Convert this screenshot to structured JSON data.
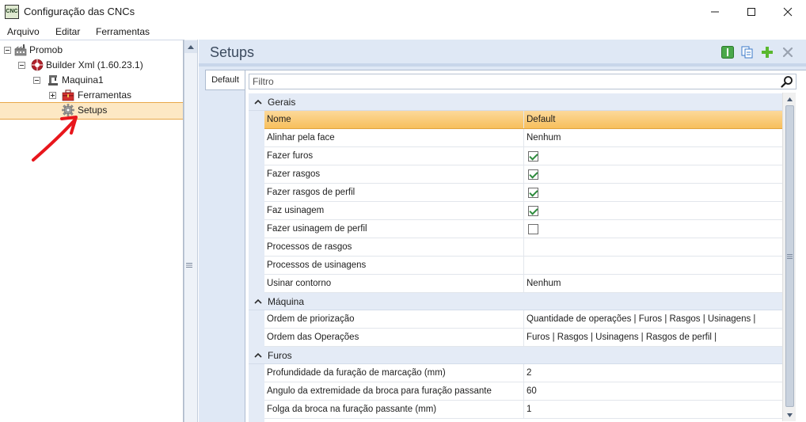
{
  "window": {
    "icon_text": "CNC",
    "title": "Configuração das CNCs"
  },
  "menu": {
    "items": [
      "Arquivo",
      "Editar",
      "Ferramentas"
    ]
  },
  "tree": {
    "nodes": [
      {
        "label": "Promob",
        "icon": "factory-icon",
        "expander": "minus"
      },
      {
        "label": "Builder Xml (1.60.23.1)",
        "icon": "builder-icon",
        "expander": "minus"
      },
      {
        "label": "Maquina1",
        "icon": "machine-icon",
        "expander": "minus"
      },
      {
        "label": "Ferramentas",
        "icon": "toolbox-icon",
        "expander": "plus"
      },
      {
        "label": "Setups",
        "icon": "gear-icon",
        "expander": "none",
        "selected": true
      }
    ]
  },
  "panel": {
    "title": "Setups",
    "toolbar": [
      {
        "icon": "info-icon",
        "color": "#4aa84a"
      },
      {
        "icon": "copy-icon",
        "color": "#3a78c8"
      },
      {
        "icon": "add-icon",
        "color": "#5ab82e"
      },
      {
        "icon": "close-icon",
        "color": "#9aa3b0"
      }
    ]
  },
  "tab": {
    "label": "Default"
  },
  "filter": {
    "placeholder": "Filtro",
    "value": ""
  },
  "grid": {
    "header": {
      "name": "Nome",
      "value": "Default"
    },
    "categories": [
      {
        "label": "Gerais",
        "rows": [
          {
            "name": "Alinhar pela face",
            "value": "Nenhum",
            "type": "text"
          },
          {
            "name": "Fazer furos",
            "value": "",
            "type": "checkbox",
            "checked": true
          },
          {
            "name": "Fazer rasgos",
            "value": "",
            "type": "checkbox",
            "checked": true
          },
          {
            "name": "Fazer rasgos de perfil",
            "value": "",
            "type": "checkbox",
            "checked": true
          },
          {
            "name": "Faz usinagem",
            "value": "",
            "type": "checkbox",
            "checked": true
          },
          {
            "name": "Fazer usinagem de perfil",
            "value": "",
            "type": "checkbox",
            "checked": false
          },
          {
            "name": "Processos de rasgos",
            "value": "",
            "type": "text"
          },
          {
            "name": "Processos de usinagens",
            "value": "",
            "type": "text"
          },
          {
            "name": "Usinar contorno",
            "value": "Nenhum",
            "type": "text"
          }
        ]
      },
      {
        "label": "Máquina",
        "rows": [
          {
            "name": "Ordem de priorização",
            "value": "Quantidade de operações | Furos | Rasgos | Usinagens |",
            "type": "text"
          },
          {
            "name": "Ordem das Operações",
            "value": "Furos | Rasgos | Usinagens | Rasgos de perfil |",
            "type": "text"
          }
        ]
      },
      {
        "label": "Furos",
        "rows": [
          {
            "name": "Profundidade da furação de marcação (mm)",
            "value": "2",
            "type": "text"
          },
          {
            "name": "Ângulo da extremidade da broca para furação passante",
            "value": "60",
            "type": "text"
          },
          {
            "name": "Folga da broca na furação passante (mm)",
            "value": "1",
            "type": "text"
          }
        ]
      }
    ]
  },
  "colors": {
    "header_orange": "#f7bf5c",
    "selection": "#fde8c4",
    "panel_bg": "#dfe8f5",
    "annotation_red": "#e8161c"
  }
}
